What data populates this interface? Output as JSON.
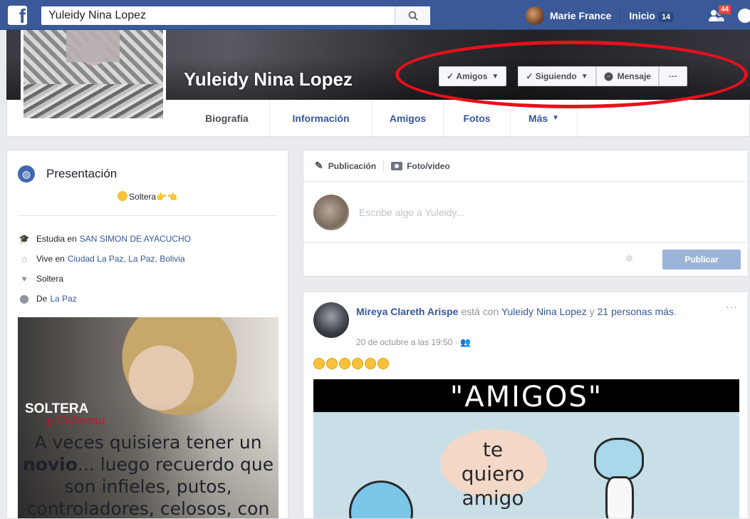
{
  "topbar": {
    "logo": "f",
    "search_value": "Yuleidy Nina Lopez",
    "user_name": "Marie France",
    "home_label": "Inicio",
    "home_count": "14",
    "friend_requests_count": "44"
  },
  "profile": {
    "name": "Yuleidy Nina Lopez",
    "actions": {
      "friends_label": "Amigos",
      "following_label": "Siguiendo",
      "message_label": "Mensaje",
      "more_label": "···"
    },
    "tabs": [
      {
        "label": "Biografía"
      },
      {
        "label": "Información"
      },
      {
        "label": "Amigos"
      },
      {
        "label": "Fotos"
      },
      {
        "label": "Más"
      }
    ]
  },
  "intro": {
    "title": "Presentación",
    "bio": "Soltera",
    "items": [
      {
        "prefix": "Estudia en",
        "link": "SAN SIMON DE AYACUCHO",
        "icon": "graduation-cap-icon"
      },
      {
        "prefix": "Vive en",
        "link": "Ciudad La Paz, La Paz, Bolivia",
        "icon": "home-icon"
      },
      {
        "prefix": "Soltera",
        "link": "",
        "icon": "heart-icon"
      },
      {
        "prefix": "De",
        "link": "La Paz",
        "icon": "location-pin-icon"
      }
    ],
    "promo": {
      "tag": "SOLTERA",
      "tag2": "y Cabrona",
      "line1": "A veces quisiera tener un",
      "line2_bold": "novio",
      "line2_rest": "... luego recuerdo que",
      "line3": "son infieles, putos,",
      "line4": "controladores, celosos, con"
    }
  },
  "composer": {
    "tab_post": "Publicación",
    "tab_photo": "Foto/video",
    "placeholder": "Escribe algo a Yuleidy...",
    "publish_label": "Publicar"
  },
  "post": {
    "author": "Mireya Clareth Arispe",
    "with_text": "está con",
    "tagged": "Yuleidy Nina Lopez",
    "and_text": "y",
    "others": "21 personas más",
    "period": ".",
    "date": "20 de octubre a las 19:50 · ",
    "more": "···",
    "image_title": "\"AMIGOS\"",
    "image_text": "te quiero amigo"
  },
  "colors": {
    "brand": "#3b5998",
    "link": "#365899",
    "highlight_ellipse": "#e8101b"
  }
}
